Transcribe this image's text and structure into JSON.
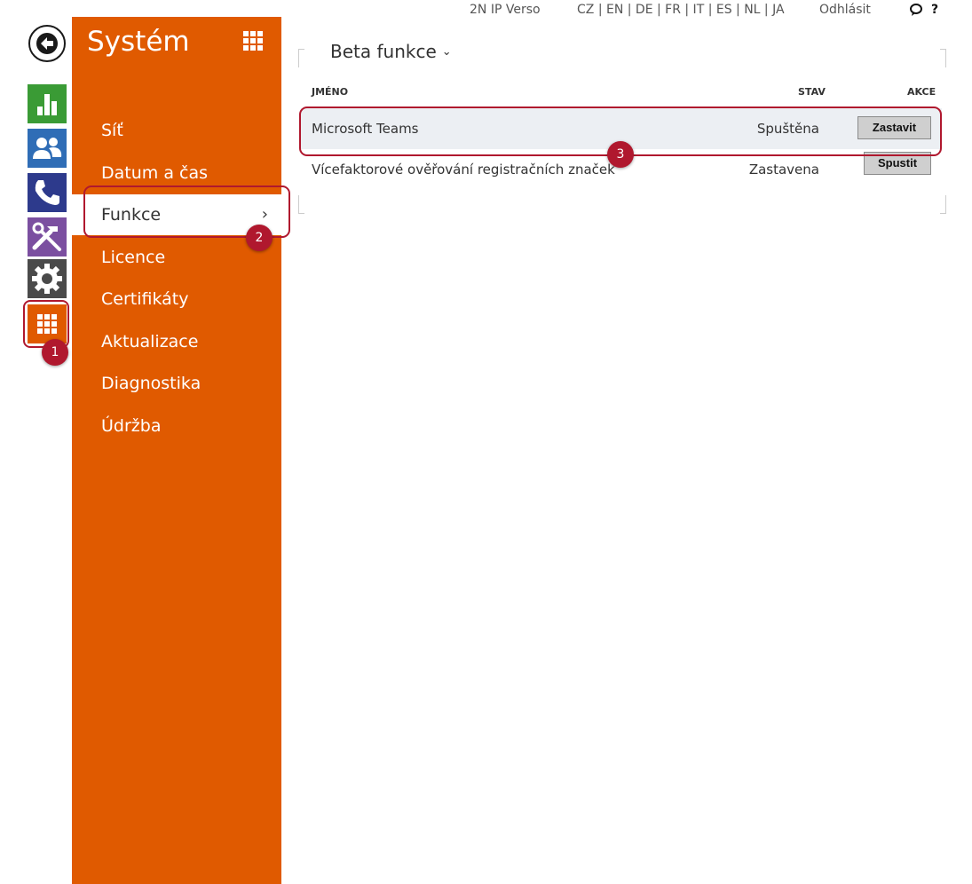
{
  "topbar": {
    "device_name": "2N IP Verso",
    "languages": "CZ | EN | DE | FR | IT | ES | NL | JA",
    "logout": "Odhlásit",
    "help": "?"
  },
  "sidebar": {
    "title": "Systém",
    "items": [
      {
        "label": "Síť"
      },
      {
        "label": "Datum a čas"
      },
      {
        "label": "Funkce",
        "chevron": "›"
      },
      {
        "label": "Licence"
      },
      {
        "label": "Certifikáty"
      },
      {
        "label": "Aktualizace"
      },
      {
        "label": "Diagnostika"
      },
      {
        "label": "Údržba"
      }
    ]
  },
  "rail": {
    "icons": [
      "back-icon",
      "status-icon",
      "users-icon",
      "phone-icon",
      "services-icon",
      "hardware-icon",
      "system-icon"
    ],
    "colors": {
      "status": "#3a9b35",
      "users": "#2f6db6",
      "phone": "#2d3a8c",
      "services": "#7b4fa0",
      "hardware": "#4a4a4a",
      "system": "#e05a00"
    }
  },
  "main": {
    "section_title": "Beta funkce",
    "columns": {
      "name": "JMÉNO",
      "state": "STAV",
      "action": "AKCE"
    },
    "rows": [
      {
        "name": "Microsoft Teams",
        "state": "Spuštěna",
        "action": "Zastavit"
      },
      {
        "name": "Vícefaktorové ověřování registračních značek",
        "state": "Zastavena",
        "action": "Spustit"
      }
    ]
  },
  "annotations": {
    "badge_1": "1",
    "badge_2": "2",
    "badge_3": "3",
    "highlight_color": "#b0182e"
  }
}
